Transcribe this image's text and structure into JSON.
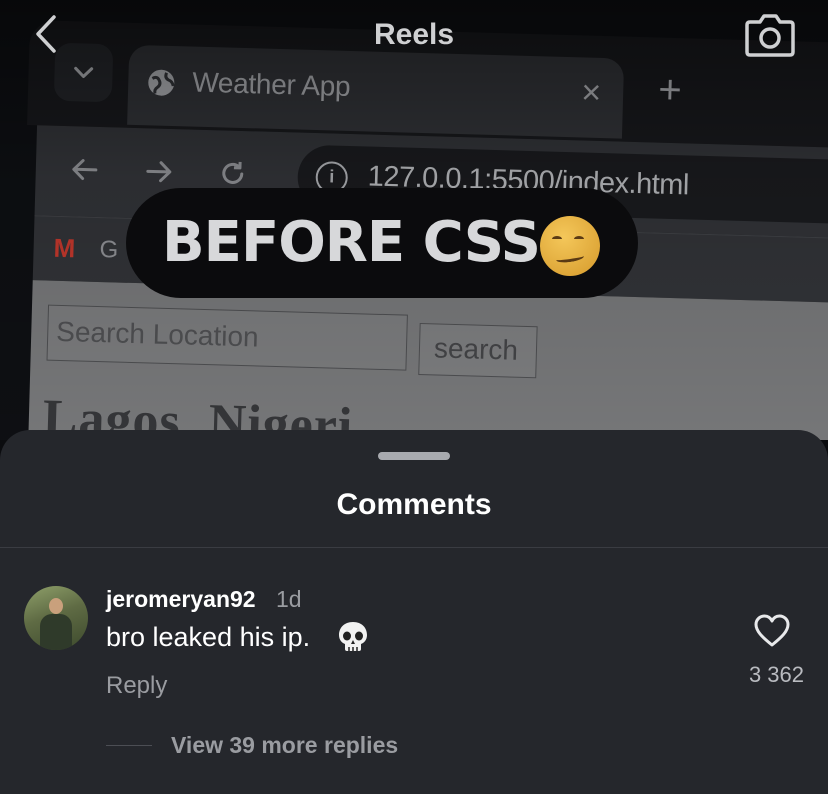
{
  "header": {
    "title": "Reels",
    "back_icon": "chevron-left-icon",
    "camera_icon": "camera-icon"
  },
  "browser": {
    "tab_title": "Weather App",
    "tab_close": "×",
    "new_tab": "+",
    "url": "127.0.0.1:5500/index.html",
    "bookmark_label": "G",
    "search_placeholder": "Search Location",
    "search_button": "search",
    "city_heading": "Lagos, Nigeri"
  },
  "caption": {
    "text": "BEFORE CSS",
    "emoji": "woozy-face"
  },
  "comments_sheet": {
    "title": "Comments",
    "comments": [
      {
        "username": "jeromeryan92",
        "time": "1d",
        "text": "bro leaked his ip.",
        "emoji": "skull",
        "reply_label": "Reply",
        "likes": "3 362",
        "view_replies": "View 39 more replies"
      }
    ]
  },
  "colors": {
    "sheet_bg": "#25272c",
    "muted_text": "#9a9ca1",
    "caption_bg": "#0b0b0d"
  }
}
